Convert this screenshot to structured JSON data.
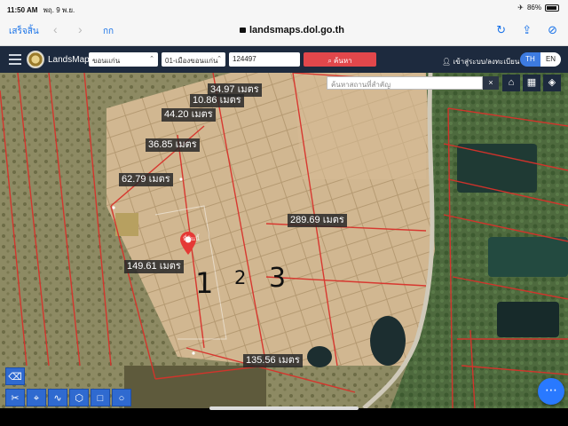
{
  "status": {
    "time": "11:50 AM",
    "date": "พฤ. 9 พ.ย.",
    "battery": "86%"
  },
  "browser": {
    "done_label": "เสร็จสิ้น",
    "reader_label": "กก",
    "url": "landsmaps.dol.go.th",
    "icons": [
      "reload-icon",
      "share-icon",
      "compass-icon"
    ]
  },
  "app": {
    "brand": "LandsMaps",
    "province": "ขอนแก่น",
    "district": "01-เมืองขอนแก่น",
    "parcel_number": "124497",
    "search_label": "ค้นหา",
    "login_label": "เข้าสู่ระบบ/ลงทะเบียน",
    "lang_th": "TH",
    "lang_en": "EN"
  },
  "map": {
    "place_search_placeholder": "ค้นหาสถานที่สำคัญ",
    "close_label": "×",
    "place_label": "ที่ดินนี้",
    "dimensions": [
      "34.97 เมตร",
      "10.86 เมตร",
      "44.20 เมตร",
      "36.85 เมตร",
      "62.79 เมตร",
      "289.69 เมตร",
      "149.61 เมตร",
      "135.56 เมตร"
    ],
    "plot_numbers": [
      "1",
      "2",
      "3"
    ],
    "colors": {
      "parcel_line": "#d8322b",
      "marker": "#e53935",
      "tool_bg": "#2f6ad0",
      "header_bg": "#1d2a3e"
    }
  }
}
